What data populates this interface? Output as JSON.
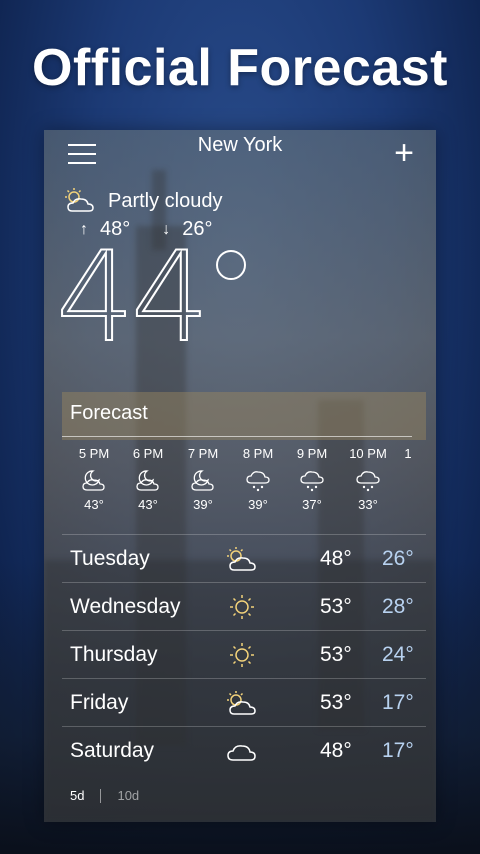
{
  "promo": {
    "headline": "Official Forecast"
  },
  "header": {
    "city": "New York",
    "add_label": "+"
  },
  "current": {
    "condition": "Partly cloudy",
    "high": "48°",
    "low": "26°",
    "temp": "44",
    "high_arrow": "↑",
    "low_arrow": "↓"
  },
  "forecast": {
    "title": "Forecast",
    "hourly": [
      {
        "time": "5 PM",
        "icon": "partly-cloudy-night-icon",
        "temp": "43°"
      },
      {
        "time": "6 PM",
        "icon": "partly-cloudy-night-icon",
        "temp": "43°"
      },
      {
        "time": "7 PM",
        "icon": "partly-cloudy-night-icon",
        "temp": "39°"
      },
      {
        "time": "8 PM",
        "icon": "rain-icon",
        "temp": "39°"
      },
      {
        "time": "9 PM",
        "icon": "rain-icon",
        "temp": "37°"
      },
      {
        "time": "10 PM",
        "icon": "rain-icon",
        "temp": "33°"
      },
      {
        "time": "1",
        "icon": "",
        "temp": ""
      }
    ],
    "daily": [
      {
        "day": "Tuesday",
        "icon": "partly-sunny-icon",
        "high": "48°",
        "low": "26°"
      },
      {
        "day": "Wednesday",
        "icon": "sun-icon",
        "high": "53°",
        "low": "28°"
      },
      {
        "day": "Thursday",
        "icon": "sun-icon",
        "high": "53°",
        "low": "24°"
      },
      {
        "day": "Friday",
        "icon": "partly-sunny-icon",
        "high": "53°",
        "low": "17°"
      },
      {
        "day": "Saturday",
        "icon": "cloud-icon",
        "high": "48°",
        "low": "17°"
      }
    ],
    "range_options": [
      "5d",
      "10d"
    ],
    "range_selected": "5d"
  },
  "colors": {
    "low_temp": "#b8d2f0",
    "background": "#1c3a75"
  }
}
